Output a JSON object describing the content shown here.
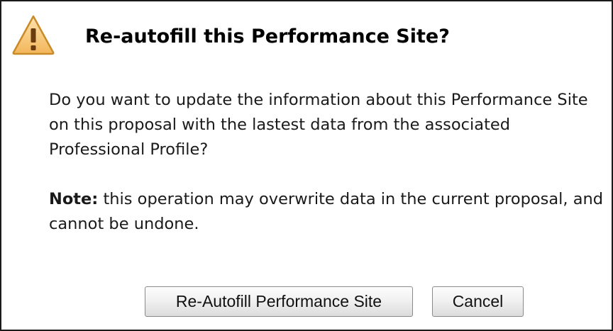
{
  "dialog": {
    "icon": "warning-icon",
    "title": "Re-autofill this Performance Site?",
    "message": "Do you want to update the information about this Performance Site on this proposal with the lastest data from the associated Professional Profile?",
    "note_label": "Note:",
    "note_text": " this operation may overwrite data in the current proposal, and cannot be undone.",
    "buttons": {
      "confirm": "Re-Autofill Performance Site",
      "cancel": "Cancel"
    }
  },
  "colors": {
    "warning_fill": "#f6c97a",
    "warning_stroke": "#c98a2a",
    "warning_mark": "#6b3d0e",
    "border": "#1a1a1a"
  }
}
